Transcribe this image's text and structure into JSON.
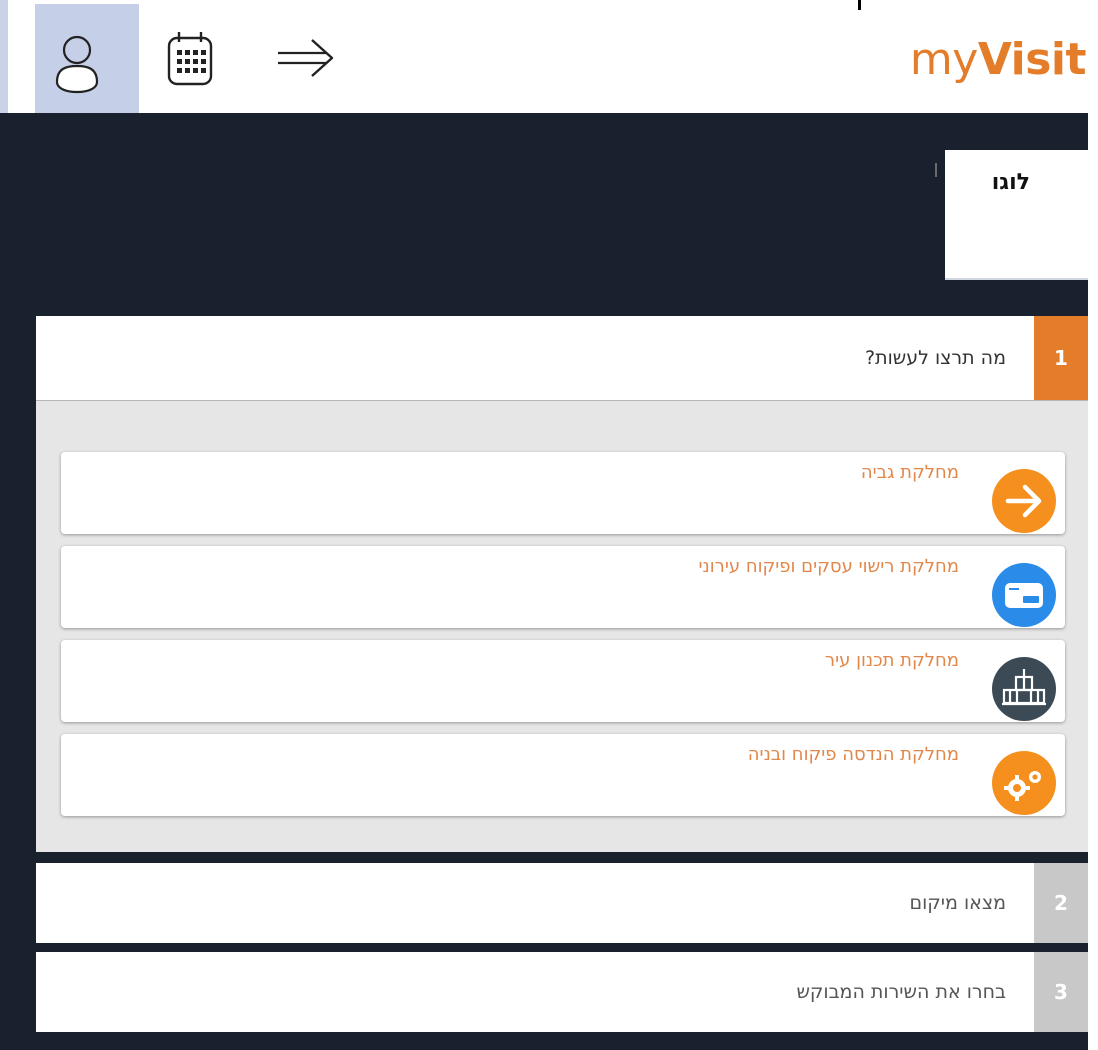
{
  "header": {
    "logo_prefix": "my",
    "logo_suffix": "Visit",
    "icons": [
      "user-icon",
      "calendar-icon",
      "forward-arrow-icon"
    ]
  },
  "logo_box": {
    "text": "לוגו"
  },
  "steps": [
    {
      "number": "1",
      "title": "מה תרצו לעשות?",
      "state": "active",
      "color": "#e37d2a"
    },
    {
      "number": "2",
      "title": "מצאו מיקום",
      "state": "inactive",
      "color": "#c8c8c8"
    },
    {
      "number": "3",
      "title": "בחרו את השירות המבוקש",
      "state": "inactive",
      "color": "#c8c8c8"
    }
  ],
  "departments": [
    {
      "label": "מחלקת גביה",
      "icon": "arrow-right-circle-icon",
      "icon_color": "#f5901e"
    },
    {
      "label": "מחלקת רישוי עסקים ופיקוח עירוני",
      "icon": "credit-card-icon",
      "icon_color": "#2a8ce8"
    },
    {
      "label": "מחלקת תכנון עיר",
      "icon": "city-hall-icon",
      "icon_color": "#3b4a55"
    },
    {
      "label": "מחלקת הנדסה פיקוח ובניה",
      "icon": "gears-icon",
      "icon_color": "#f5901e"
    }
  ],
  "colors": {
    "brand_orange": "#e37d2a",
    "dark_background": "#19212e",
    "department_text": "#e2874a"
  }
}
